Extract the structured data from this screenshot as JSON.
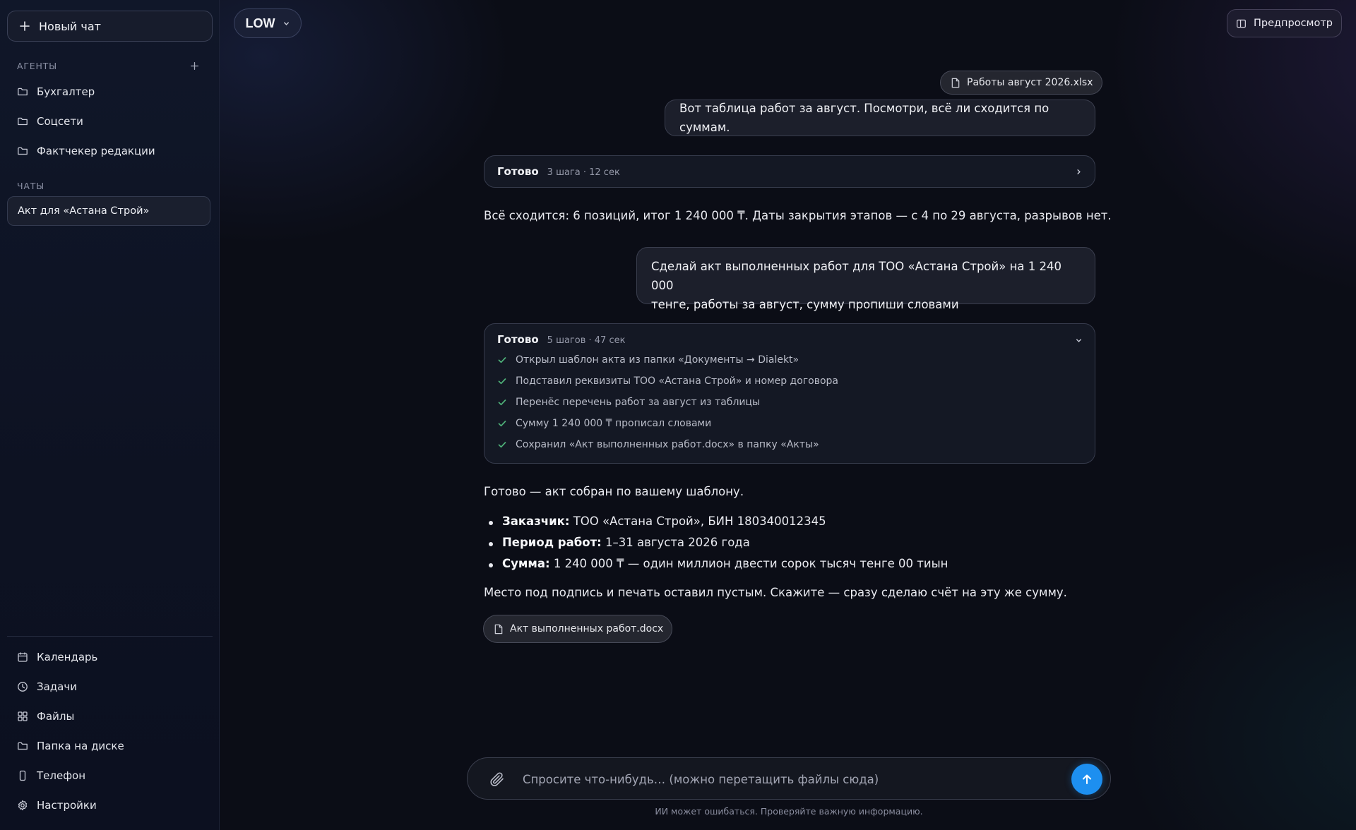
{
  "sidebar": {
    "new_chat_label": "Новый чат",
    "agents_label": "АГЕНТЫ",
    "agents": [
      {
        "label": "Бухгалтер",
        "icon": "folder-icon"
      },
      {
        "label": "Соцсети",
        "icon": "folder-icon"
      },
      {
        "label": "Фактчекер редакции",
        "icon": "folder-icon"
      }
    ],
    "chats_label": "ЧАТЫ",
    "chats": [
      {
        "label": "Акт для «Астана Строй»",
        "active": true
      }
    ],
    "bottom_nav": [
      {
        "label": "Календарь",
        "icon": "calendar-icon"
      },
      {
        "label": "Задачи",
        "icon": "clock-icon"
      },
      {
        "label": "Файлы",
        "icon": "grid-icon"
      },
      {
        "label": "Папка на диске",
        "icon": "folder-icon"
      },
      {
        "label": "Телефон",
        "icon": "phone-icon"
      },
      {
        "label": "Настройки",
        "icon": "gear-icon"
      }
    ]
  },
  "header": {
    "model_label": "LOW",
    "preview_label": "Предпросмотр"
  },
  "conversation": {
    "msg1_attachment": "Работы август 2026.xlsx",
    "msg1_text": "Вот таблица работ за август. Посмотри, всё ли сходится по суммам.",
    "status1": {
      "title": "Готово",
      "meta": "3 шага · 12 сек"
    },
    "answer1": "Всё сходится: 6 позиций, итог 1 240 000 ₸. Даты закрытия этапов — с 4 по 29 августа, разрывов нет.",
    "msg2_line1": "Сделай акт выполненных работ для ТОО «Астана Строй» на 1 240 000",
    "msg2_line2": "тенге, работы за август, сумму пропиши словами",
    "status2": {
      "title": "Готово",
      "meta": "5 шагов · 47 сек",
      "steps": [
        "Открыл шаблон акта из папки «Документы → Dialekt»",
        "Подставил реквизиты ТОО «Астана Строй» и номер договора",
        "Перенёс перечень работ за август из таблицы",
        "Сумму 1 240 000 ₸ прописал словами",
        "Сохранил «Акт выполненных работ.docx» в папку «Акты»"
      ]
    },
    "answer2_intro": "Готово — акт собран по вашему шаблону.",
    "answer2_bullets": [
      {
        "label": "Заказчик:",
        "value": " ТОО «Астана Строй», БИН 180340012345"
      },
      {
        "label": "Период работ:",
        "value": " 1–31 августа 2026 года"
      },
      {
        "label": "Сумма:",
        "value": " 1 240 000 ₸ — один миллион двести сорок тысяч тенге 00 тиын"
      }
    ],
    "answer2_outro": "Место под подпись и печать оставил пустым. Скажите — сразу сделаю счёт на эту же сумму.",
    "answer2_attachment": "Акт выполненных работ.docx"
  },
  "composer": {
    "placeholder": "Спросите что-нибудь… (можно перетащить файлы сюда)",
    "value": "",
    "disclaimer": "ИИ может ошибаться. Проверяйте важную информацию."
  },
  "colors": {
    "accent": "#1d8ff0",
    "check": "#4fb37a",
    "background": "#0b0d16"
  }
}
